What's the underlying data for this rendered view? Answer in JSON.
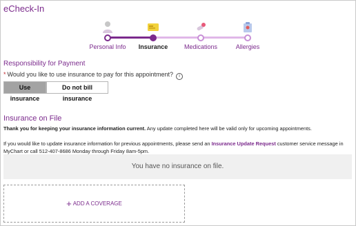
{
  "app": {
    "title": "eCheck-In"
  },
  "steps": [
    {
      "label": "Personal Info",
      "state": "complete",
      "icon": "person-icon"
    },
    {
      "label": "Insurance",
      "state": "current",
      "icon": "insurance-card-icon"
    },
    {
      "label": "Medications",
      "state": "pending",
      "icon": "medications-icon"
    },
    {
      "label": "Allergies",
      "state": "pending",
      "icon": "allergies-icon"
    }
  ],
  "payment": {
    "title": "Responsibility for Payment",
    "required_marker": "*",
    "question": "Would you like to use insurance to pay for this appointment?",
    "info_icon": "i",
    "options": [
      "Use insurance",
      "Do not bill insurance"
    ],
    "selected": "Use insurance"
  },
  "insurance": {
    "title": "Insurance on File",
    "thanks_bold": "Thank you for keeping your insurance information current.",
    "thanks_rest": " Any update completed here will be valid only for upcoming appointments.",
    "instructions_pre": "If you would like to update insurance information for previous appointments, please send an ",
    "instructions_link": "Insurance Update Request",
    "instructions_post": " customer service message in MyChart or call 512-407-8686 Monday through Friday 8am-5pm.",
    "empty_message": "You have no insurance on file.",
    "add_coverage_icon": "+",
    "add_coverage_label": "ADD A COVERAGE"
  },
  "colors": {
    "accent": "#7b2a8c",
    "accent_light": "#e0b7e8",
    "selected_button": "#a3a3a3",
    "required": "#c0272d"
  }
}
